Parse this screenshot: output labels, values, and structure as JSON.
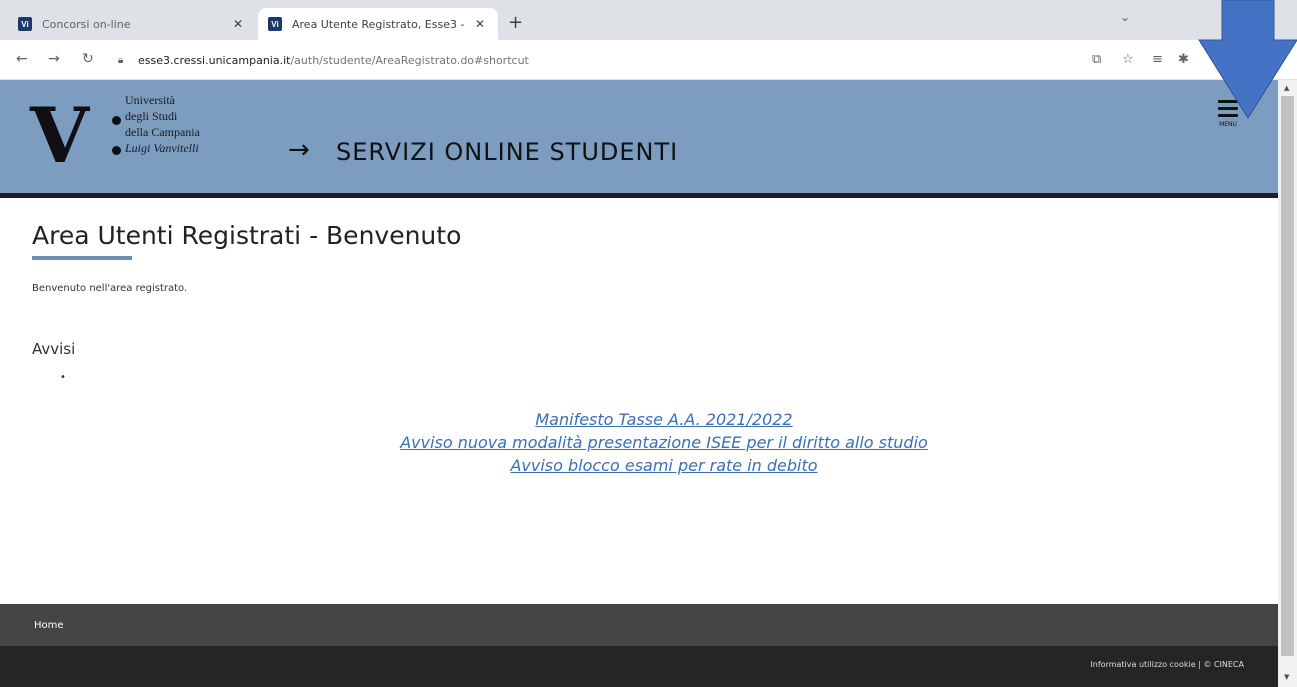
{
  "browser": {
    "tabs": [
      {
        "label": "Concorsi on-line",
        "active": false
      },
      {
        "label": "Area Utente Registrato, Esse3 - ",
        "active": true
      }
    ],
    "url_host": "esse3.cressi.unicampania.it",
    "url_path": "/auth/studente/AreaRegistrato.do#shortcut"
  },
  "header": {
    "logo_lines": [
      "Università",
      "degli Studi",
      "della Campania",
      "Luigi Vanvitelli"
    ],
    "logo_letter": "V",
    "arrow": "→",
    "title": "SERVIZI ONLINE STUDENTI",
    "menu_label": "MENU"
  },
  "main": {
    "title": "Area Utenti Registrati - Benvenuto",
    "welcome": "Benvenuto nell'area registrato.",
    "avvisi_heading": "Avvisi",
    "bullet": "•",
    "links": [
      "Manifesto Tasse A.A. 2021/2022",
      "Avviso nuova modalità presentazione ISEE per il diritto allo studio",
      "Avviso blocco esami per rate in debito"
    ]
  },
  "footer": {
    "nav_home": "Home",
    "legal": "Informativa utilizzo cookie | © CINECA"
  },
  "colors": {
    "header_bg": "#7d9dc0",
    "link": "#3b6fb6",
    "annotation_arrow": "#4472c4"
  }
}
